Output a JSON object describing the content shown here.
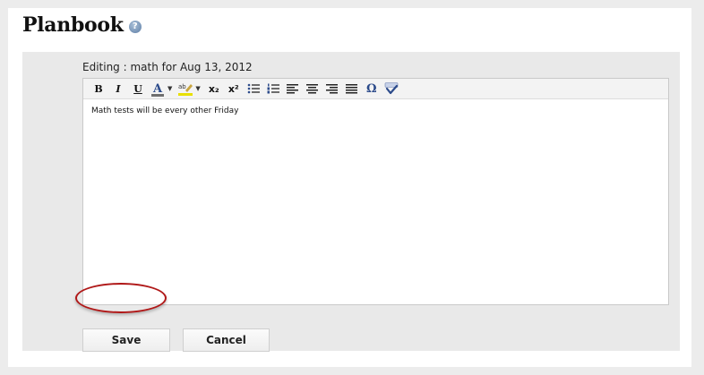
{
  "page": {
    "title": "Planbook",
    "help_icon_glyph": "?"
  },
  "editor": {
    "label": "Editing : math for Aug 13, 2012",
    "content": "Math tests will be every other Friday",
    "toolbar": [
      {
        "name": "bold-button",
        "glyph": "B"
      },
      {
        "name": "italic-button",
        "glyph": "I"
      },
      {
        "name": "underline-button",
        "glyph": "U"
      },
      {
        "name": "font-color-button",
        "glyph": "A"
      },
      {
        "name": "highlight-color-button",
        "icon": "highlighter-icon"
      },
      {
        "name": "subscript-button",
        "glyph": "x₂"
      },
      {
        "name": "superscript-button",
        "glyph": "x²"
      },
      {
        "name": "bulleted-list-button",
        "icon": "bulleted-list-icon"
      },
      {
        "name": "numbered-list-button",
        "icon": "numbered-list-icon"
      },
      {
        "name": "align-left-button",
        "icon": "align-left-icon"
      },
      {
        "name": "align-center-button",
        "icon": "align-center-icon"
      },
      {
        "name": "align-right-button",
        "icon": "align-right-icon"
      },
      {
        "name": "justify-button",
        "icon": "align-justify-icon"
      },
      {
        "name": "special-character-button",
        "glyph": "Ω"
      },
      {
        "name": "spellcheck-button",
        "icon": "spellcheck-icon"
      }
    ]
  },
  "buttons": {
    "save_label": "Save",
    "cancel_label": "Cancel"
  },
  "colors": {
    "highlight_ring": "#b01818",
    "accent": "#2b4a8a"
  }
}
